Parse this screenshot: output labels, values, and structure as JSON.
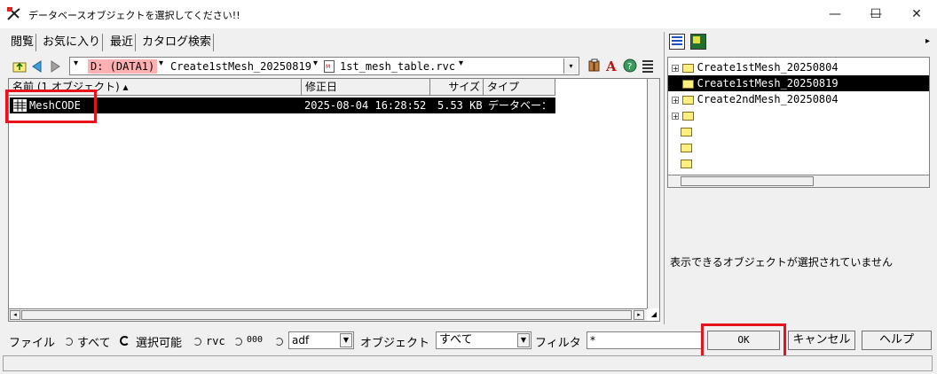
{
  "window": {
    "title": "データベースオブジェクトを選択してください!!",
    "minimize_glyph": "—",
    "maximize_glyph": "☐",
    "close_glyph": "✕"
  },
  "tabs": [
    {
      "label": "閲覧"
    },
    {
      "label": "お気に入り"
    },
    {
      "label": "最近"
    },
    {
      "label": "カタログ検索"
    }
  ],
  "path": {
    "drive": "D: (DATA1)",
    "folder": "Create1stMesh_20250819",
    "file": "1st_mesh_table.rvc",
    "dropdown_glyph": "▾"
  },
  "file_list": {
    "columns": [
      {
        "label": "名前 (1 オブジェクト) ▴"
      },
      {
        "label": "修正日"
      },
      {
        "label": "サイズ"
      },
      {
        "label": "タイプ"
      }
    ],
    "rows": [
      {
        "name": "MeshCODE",
        "modified": "2025-08-04 16:28:52",
        "size": "5.53 KB",
        "type": "データベー："
      }
    ]
  },
  "tree": {
    "items": [
      {
        "label": "Create1stMesh_20250804",
        "expander": "+"
      },
      {
        "label": "Create1stMesh_20250819",
        "expander": ""
      },
      {
        "label": "Create2ndMesh_20250804",
        "expander": "+"
      }
    ]
  },
  "right_message": "表示できるオブジェクトが選択されていません",
  "filter_bar": {
    "file_label": "ファイル",
    "radio_all": "すべて",
    "radio_selectable": "選択可能",
    "radio_rvc": "rvc",
    "radio_000": "000",
    "format_value": "adf",
    "object_label": "オブジェクト",
    "object_value": "すべて",
    "filter_label": "フィルタ",
    "filter_value": "*"
  },
  "buttons": {
    "ok": "OK",
    "cancel": "キャンセル",
    "help": "ヘルプ"
  },
  "colors": {
    "highlight": "#e8121c",
    "selection": "#000000",
    "drive_bg": "#ffb0b0"
  }
}
